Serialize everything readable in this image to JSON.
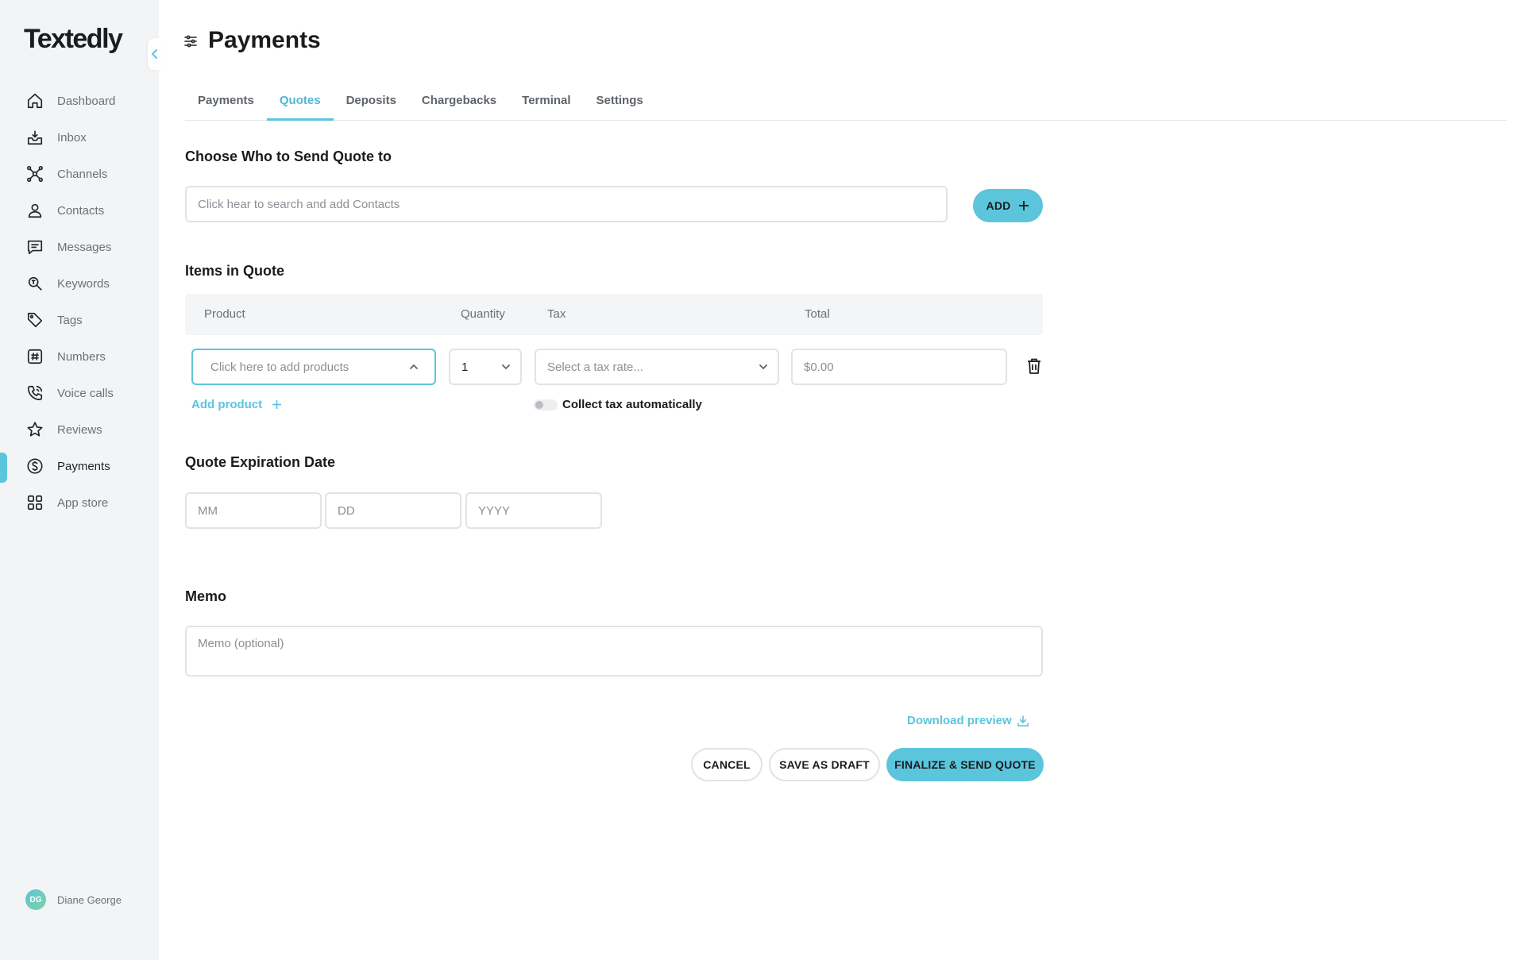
{
  "app": {
    "logo": "Textedly"
  },
  "sidebar": {
    "items": [
      {
        "label": "Dashboard",
        "icon": "home-icon"
      },
      {
        "label": "Inbox",
        "icon": "inbox-icon"
      },
      {
        "label": "Channels",
        "icon": "channels-icon"
      },
      {
        "label": "Contacts",
        "icon": "user-icon"
      },
      {
        "label": "Messages",
        "icon": "message-icon"
      },
      {
        "label": "Keywords",
        "icon": "keyword-icon"
      },
      {
        "label": "Tags",
        "icon": "tag-icon"
      },
      {
        "label": "Numbers",
        "icon": "hash-icon"
      },
      {
        "label": "Voice calls",
        "icon": "phone-icon"
      },
      {
        "label": "Reviews",
        "icon": "star-icon"
      },
      {
        "label": "Payments",
        "icon": "dollar-icon",
        "active": true
      },
      {
        "label": "App store",
        "icon": "grid-icon"
      }
    ],
    "user": {
      "initials": "DG",
      "name": "Diane George"
    }
  },
  "header": {
    "title": "Payments"
  },
  "tabs": [
    {
      "label": "Payments"
    },
    {
      "label": "Quotes",
      "active": true
    },
    {
      "label": "Deposits"
    },
    {
      "label": "Chargebacks"
    },
    {
      "label": "Terminal"
    },
    {
      "label": "Settings"
    }
  ],
  "recipient": {
    "title": "Choose Who to Send Quote to",
    "placeholder": "Click hear to search and add Contacts",
    "add_label": "ADD"
  },
  "items": {
    "title": "Items in Quote",
    "columns": {
      "product": "Product",
      "quantity": "Quantity",
      "tax": "Tax",
      "total": "Total"
    },
    "product_placeholder": "Click here to add products",
    "quantity_value": "1",
    "tax_placeholder": "Select a tax rate...",
    "total_placeholder": "$0.00",
    "add_product_label": "Add product",
    "collect_tax_label": "Collect tax automatically"
  },
  "expiration": {
    "title": "Quote Expiration Date",
    "mm": "MM",
    "dd": "DD",
    "yyyy": "YYYY"
  },
  "memo": {
    "title": "Memo",
    "placeholder": "Memo (optional)"
  },
  "actions": {
    "download_preview": "Download preview",
    "cancel": "CANCEL",
    "save_draft": "SAVE AS DRAFT",
    "finalize": "FINALIZE & SEND QUOTE"
  },
  "colors": {
    "accent": "#5bc5dc",
    "sidebar_bg": "#f3f4f5"
  }
}
